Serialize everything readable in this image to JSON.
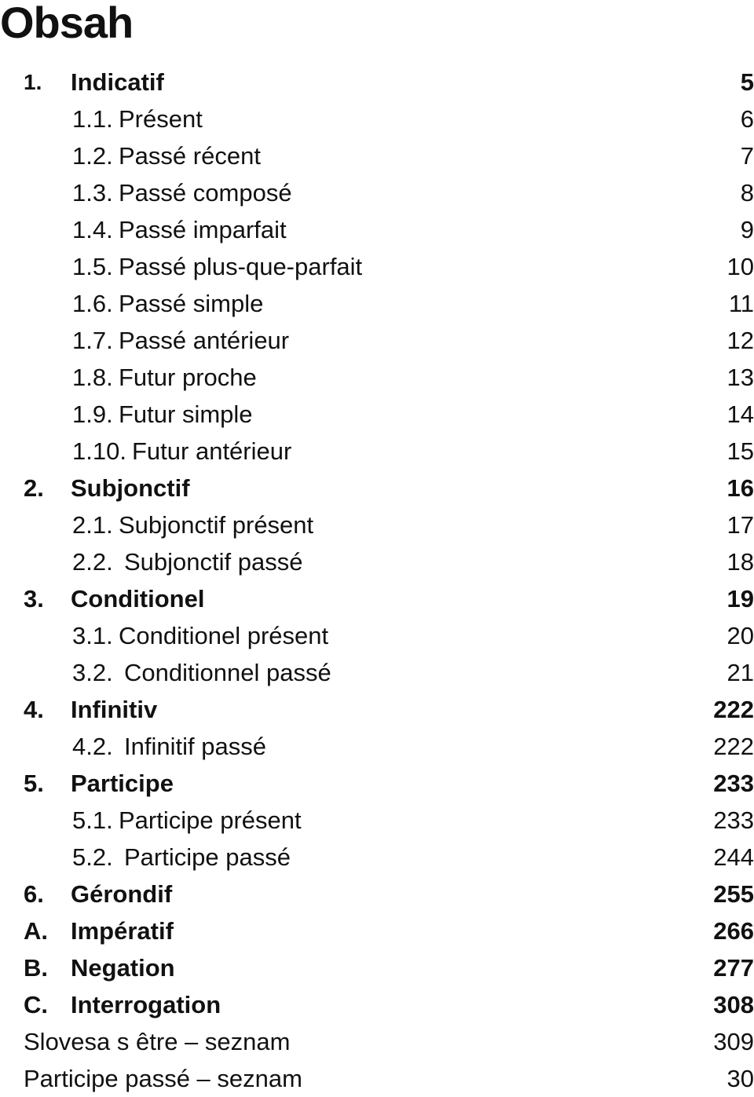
{
  "title": "Obsah",
  "toc": [
    {
      "num": "1.",
      "label": "Indicatif",
      "page": "5",
      "level": "chapter"
    },
    {
      "num": "1.1.",
      "label": "Présent",
      "page": "6",
      "level": "section"
    },
    {
      "num": "1.2.",
      "label": "Passé récent",
      "page": "7",
      "level": "section"
    },
    {
      "num": "1.3.",
      "label": "Passé composé",
      "page": "8",
      "level": "section"
    },
    {
      "num": "1.4.",
      "label": "Passé imparfait",
      "page": "9",
      "level": "section"
    },
    {
      "num": "1.5.",
      "label": "Passé plus-que-parfait",
      "page": "10",
      "level": "section"
    },
    {
      "num": "1.6.",
      "label": "Passé simple",
      "page": "11",
      "level": "section"
    },
    {
      "num": "1.7.",
      "label": "Passé antérieur",
      "page": "12",
      "level": "section"
    },
    {
      "num": "1.8.",
      "label": "Futur proche",
      "page": "13",
      "level": "section"
    },
    {
      "num": "1.9.",
      "label": "Futur simple",
      "page": "14",
      "level": "section"
    },
    {
      "num": "1.10.",
      "label": "Futur antérieur",
      "page": "15",
      "level": "section"
    },
    {
      "num": "2.",
      "label": "Subjonctif",
      "page": "16",
      "level": "chapter"
    },
    {
      "num": "2.1.",
      "label": "Subjonctif présent",
      "page": "17",
      "level": "section"
    },
    {
      "num": "2.2.",
      "label": "Subjonctif passé",
      "page": "18",
      "level": "section"
    },
    {
      "num": "3.",
      "label": "Conditionel",
      "page": "19",
      "level": "chapter"
    },
    {
      "num": "3.1.",
      "label": "Conditionel présent",
      "page": "20",
      "level": "section"
    },
    {
      "num": "3.2.",
      "label": "Conditionnel passé",
      "page": "21",
      "level": "section"
    },
    {
      "num": "4.",
      "label": "Infinitiv",
      "page": "222",
      "level": "chapter"
    },
    {
      "num": "4.2.",
      "label": "Infinitif passé",
      "page": "222",
      "level": "section"
    },
    {
      "num": "5.",
      "label": "Participe",
      "page": "233",
      "level": "chapter"
    },
    {
      "num": "5.1.",
      "label": "Participe présent",
      "page": "233",
      "level": "section"
    },
    {
      "num": "5.2.",
      "label": "Participe passé",
      "page": "244",
      "level": "section"
    },
    {
      "num": "6.",
      "label": "Gérondif",
      "page": "255",
      "level": "chapter"
    },
    {
      "num": "A.",
      "label": "Impératif",
      "page": "266",
      "level": "chapter"
    },
    {
      "num": "B.",
      "label": "Negation",
      "page": "277",
      "level": "chapter"
    },
    {
      "num": "C.",
      "label": "Interrogation",
      "page": "308",
      "level": "chapter"
    },
    {
      "num": "",
      "label": "Slovesa s être – seznam",
      "page": "309",
      "level": "appendix"
    },
    {
      "num": "",
      "label": "Participe passé – seznam",
      "page": "30",
      "level": "appendix"
    }
  ]
}
